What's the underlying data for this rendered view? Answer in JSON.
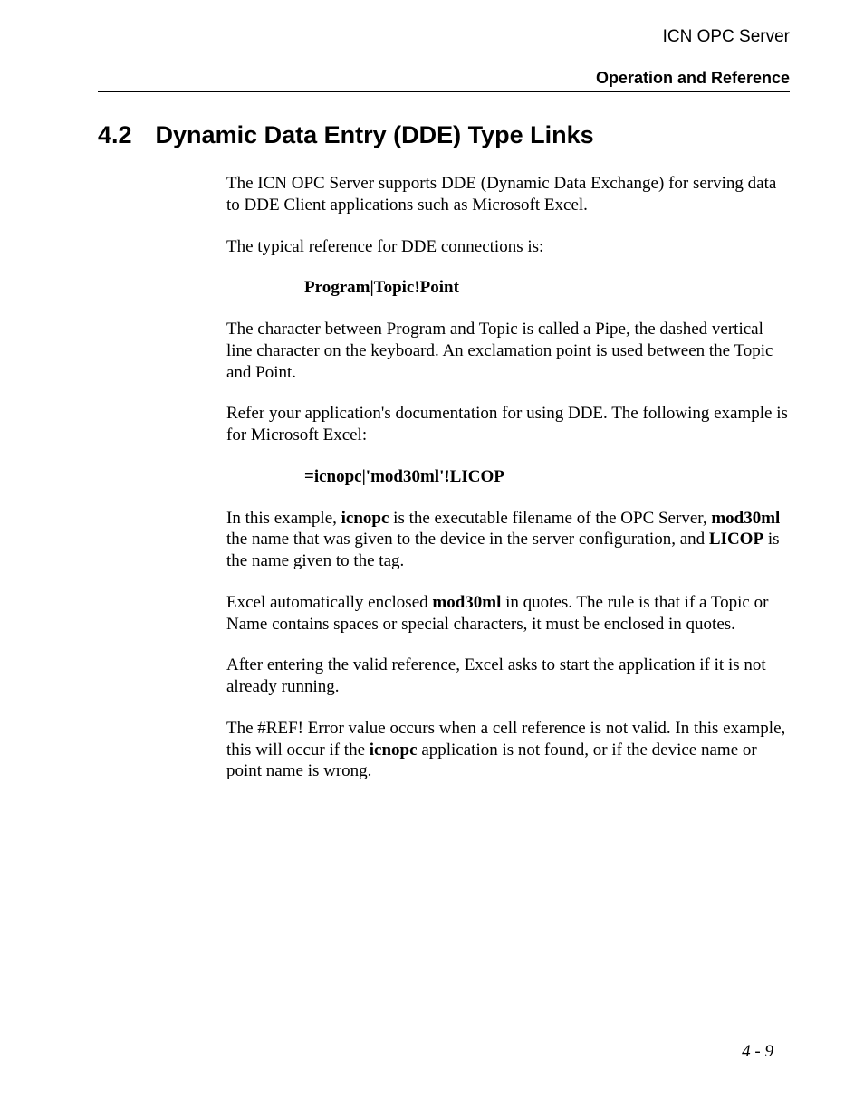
{
  "header": {
    "doc_title": "ICN OPC Server",
    "chapter": "Operation and Reference"
  },
  "heading": {
    "number": "4.2",
    "title": "Dynamic Data Entry (DDE) Type Links"
  },
  "para": {
    "p1": "The ICN OPC Server supports DDE (Dynamic Data Exchange) for serving data to DDE Client applications such as Microsoft Excel.",
    "p2": "The typical reference for DDE connections is:",
    "block1": "Program|Topic!Point",
    "p3": "The character between Program and Topic is called a Pipe, the dashed vertical line character on the keyboard. An exclamation point is used between the Topic and Point.",
    "p4": "Refer your application's documentation for using DDE. The following example is for Microsoft Excel:",
    "block2": "=icnopc|'mod30ml'!LICOP",
    "p5a": "In this example, ",
    "p5b_bold": "icnopc",
    "p5c": " is the executable filename of the OPC Server, ",
    "p5d_bold": "mod30ml",
    "p5e": " the name that was given to the device in the server configuration, and ",
    "p5f_bold": "LICOP",
    "p5g": " is the name given to the tag.",
    "p6a": "Excel automatically enclosed ",
    "p6b_bold": "mod30ml",
    "p6c": " in quotes. The rule is that if a Topic or Name contains spaces or special characters, it must be enclosed in quotes.",
    "p7": "After entering the valid reference, Excel asks to start the application if it is not already running.",
    "p8a": "The #REF! Error value occurs when a cell reference is not valid. In this example, this will occur if the ",
    "p8b_bold": "icnopc",
    "p8c": " application is not found, or if the device name or point name is wrong."
  },
  "footer": {
    "page_number": "4 - 9"
  }
}
